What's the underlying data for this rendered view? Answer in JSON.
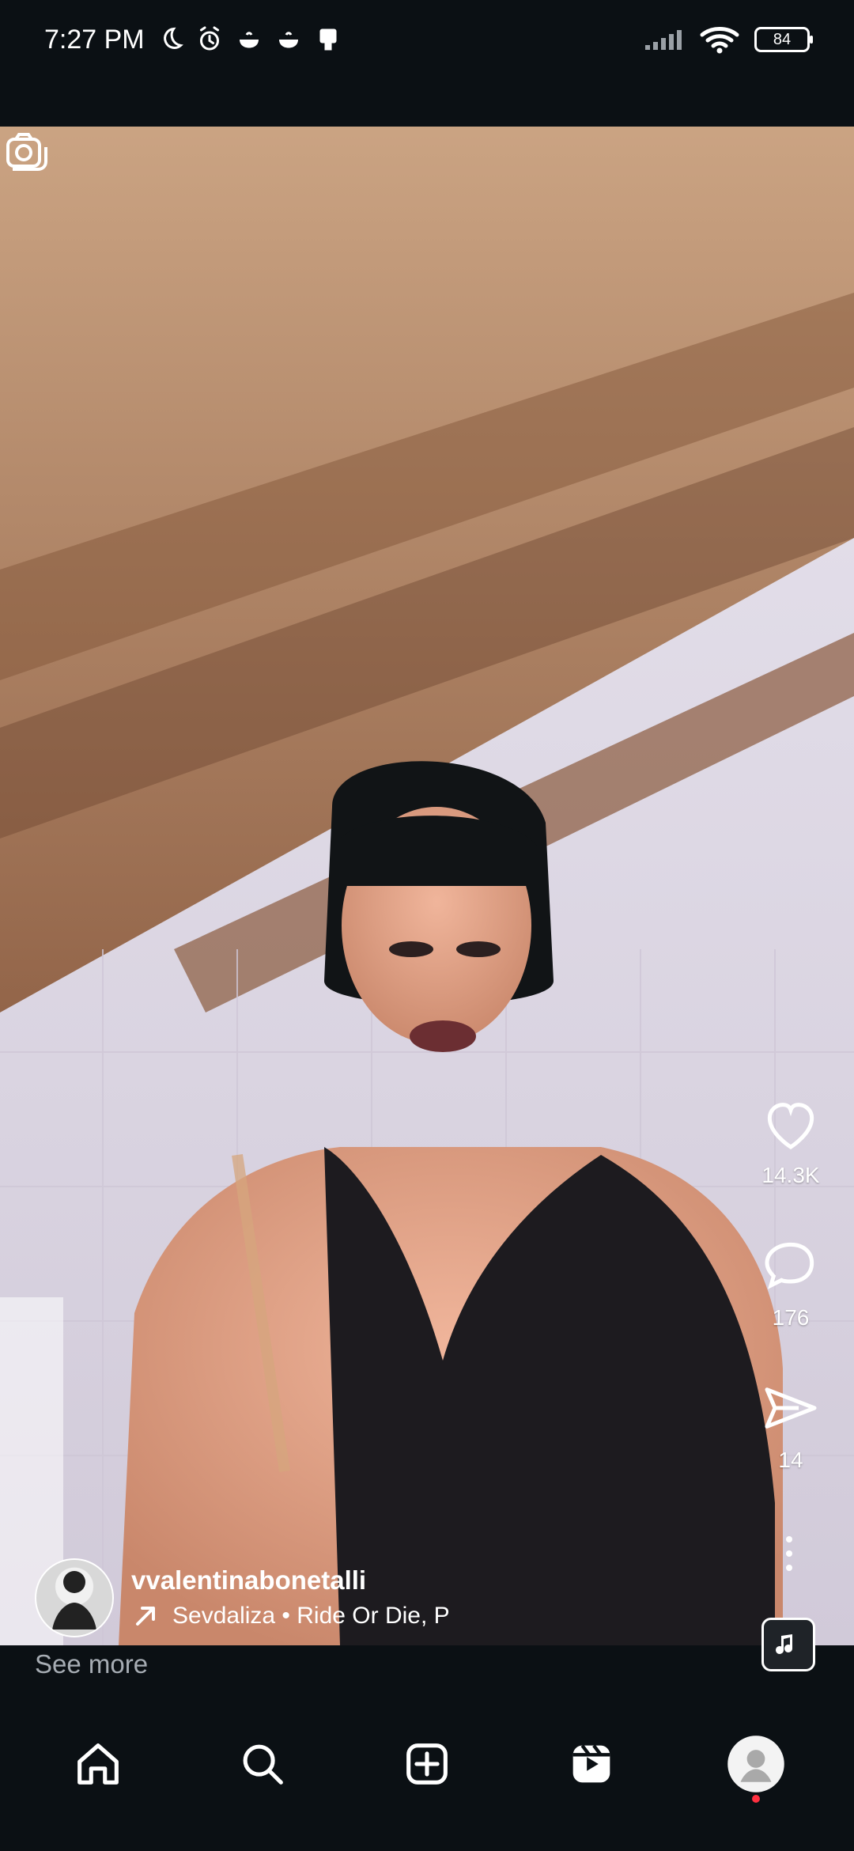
{
  "status": {
    "time": "7:27 PM",
    "battery": "84"
  },
  "post": {
    "username": "vvalentinabonetalli",
    "audio": "Sevdaliza • Ride Or Die, P",
    "see_more": "See more"
  },
  "actions": {
    "likes": "14.3K",
    "comments": "176",
    "shares": "14"
  },
  "colors": {
    "background": "#0b1014",
    "notification": "#ff3040"
  },
  "icons": [
    "camera-icon",
    "heart-icon",
    "comment-icon",
    "share-icon",
    "more-icon",
    "music-icon",
    "home-icon",
    "search-icon",
    "create-icon",
    "reels-icon",
    "profile-icon"
  ]
}
